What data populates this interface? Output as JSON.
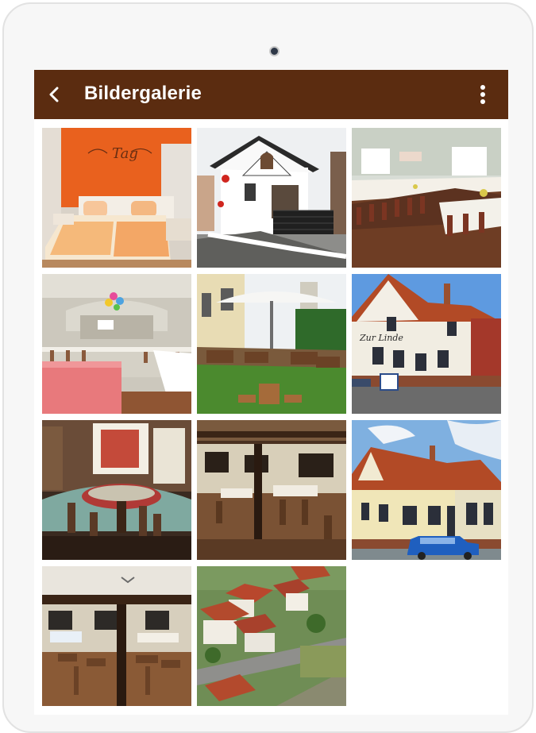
{
  "app_bar": {
    "title": "Bildergalerie",
    "back_icon": "arrow-back-icon",
    "menu_icon": "more-vertical-icon",
    "background_color": "#5b2c10"
  },
  "gallery": {
    "photos": [
      {
        "name": "gallery-photo-hotel-room",
        "wall_text": "Tag"
      },
      {
        "name": "gallery-photo-house-exterior"
      },
      {
        "name": "gallery-photo-banquet-hall"
      },
      {
        "name": "gallery-photo-festive-hall"
      },
      {
        "name": "gallery-photo-beer-garden"
      },
      {
        "name": "gallery-photo-inn-facade",
        "sign_text": "Zur Linde"
      },
      {
        "name": "gallery-photo-lounge"
      },
      {
        "name": "gallery-photo-restaurant"
      },
      {
        "name": "gallery-photo-inn-street-view"
      },
      {
        "name": "gallery-photo-dining-room"
      },
      {
        "name": "gallery-photo-village-aerial"
      }
    ]
  }
}
